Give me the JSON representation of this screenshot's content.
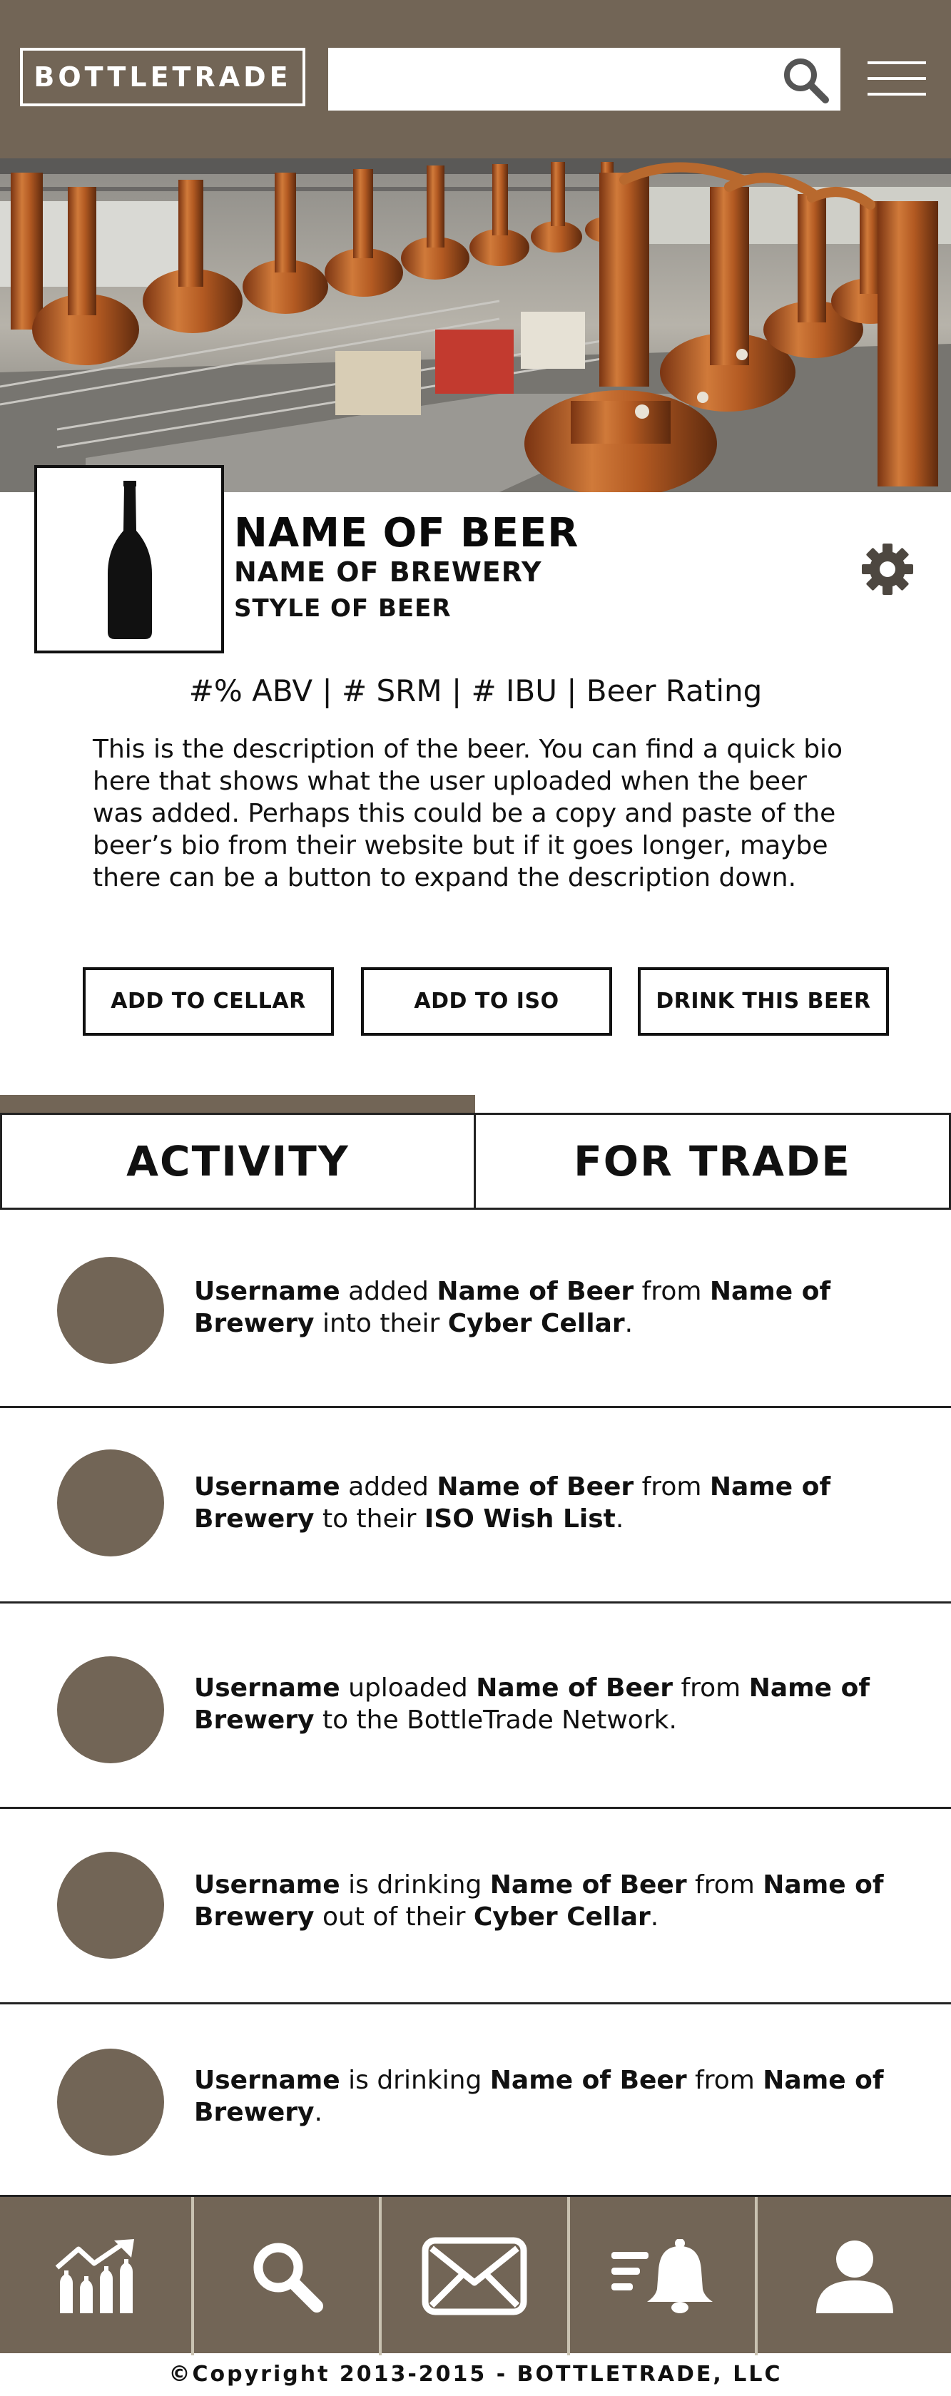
{
  "header": {
    "logo": "BOTTLETRADE",
    "search_placeholder": "",
    "icons": [
      "search-icon",
      "menu-icon"
    ]
  },
  "beer": {
    "name": "NAME OF BEER",
    "brewery": "NAME OF BREWERY",
    "style": "STYLE OF BEER",
    "stats": "#% ABV | # SRM | # IBU | Beer Rating",
    "description": "This is the description of the beer. You can find a quick bio here that shows what the user uploaded when the beer was added. Perhaps this could be a copy and paste of the beer’s bio from their website but if it goes longer, maybe there can be a button to expand the description down."
  },
  "actions": {
    "add_to_cellar": "ADD TO CELLAR",
    "add_to_iso": "ADD TO ISO",
    "drink_this_beer": "DRINK THIS BEER"
  },
  "tabs": {
    "activity": "ACTIVITY",
    "for_trade": "FOR TRADE"
  },
  "activity": [
    {
      "parts": [
        {
          "t": "Username",
          "b": true
        },
        {
          "t": " added ",
          "b": false
        },
        {
          "t": "Name of Beer",
          "b": true
        },
        {
          "t": " from ",
          "b": false
        },
        {
          "t": "Name of Brewery",
          "b": true
        },
        {
          "t": " into their ",
          "b": false
        },
        {
          "t": "Cyber Cellar",
          "b": true
        },
        {
          "t": ".",
          "b": false
        }
      ]
    },
    {
      "parts": [
        {
          "t": "Username",
          "b": true
        },
        {
          "t": " added ",
          "b": false
        },
        {
          "t": "Name of Beer",
          "b": true
        },
        {
          "t": " from ",
          "b": false
        },
        {
          "t": "Name of Brewery",
          "b": true
        },
        {
          "t": " to their ",
          "b": false
        },
        {
          "t": "ISO Wish List",
          "b": true
        },
        {
          "t": ".",
          "b": false
        }
      ]
    },
    {
      "parts": [
        {
          "t": "Username",
          "b": true
        },
        {
          "t": " uploaded ",
          "b": false
        },
        {
          "t": "Name of Beer",
          "b": true
        },
        {
          "t": " from ",
          "b": false
        },
        {
          "t": "Name of Brewery",
          "b": true
        },
        {
          "t": " to the BottleTrade Network.",
          "b": false
        }
      ]
    },
    {
      "parts": [
        {
          "t": "Username",
          "b": true
        },
        {
          "t": " is drinking ",
          "b": false
        },
        {
          "t": "Name of Beer",
          "b": true
        },
        {
          "t": " from ",
          "b": false
        },
        {
          "t": "Name of Brewery",
          "b": true
        },
        {
          "t": " out of their ",
          "b": false
        },
        {
          "t": "Cyber Cellar",
          "b": true
        },
        {
          "t": ".",
          "b": false
        }
      ]
    },
    {
      "parts": [
        {
          "t": "Username",
          "b": true
        },
        {
          "t": " is drinking ",
          "b": false
        },
        {
          "t": "Name of Beer",
          "b": true
        },
        {
          "t": " from ",
          "b": false
        },
        {
          "t": "Name of Brewery",
          "b": true
        },
        {
          "t": ".",
          "b": false
        }
      ]
    }
  ],
  "bottom_nav": {
    "items": [
      "stats-icon",
      "search-icon",
      "mail-icon",
      "notifications-icon",
      "profile-icon"
    ]
  },
  "footer": {
    "copyright": "©Copyright 2013-2015 - BOTTLETRADE, LLC"
  },
  "colors": {
    "brand": "#726556",
    "copper": "#b5652a",
    "background": "#ffffff",
    "divider": "#c9c2b1"
  }
}
